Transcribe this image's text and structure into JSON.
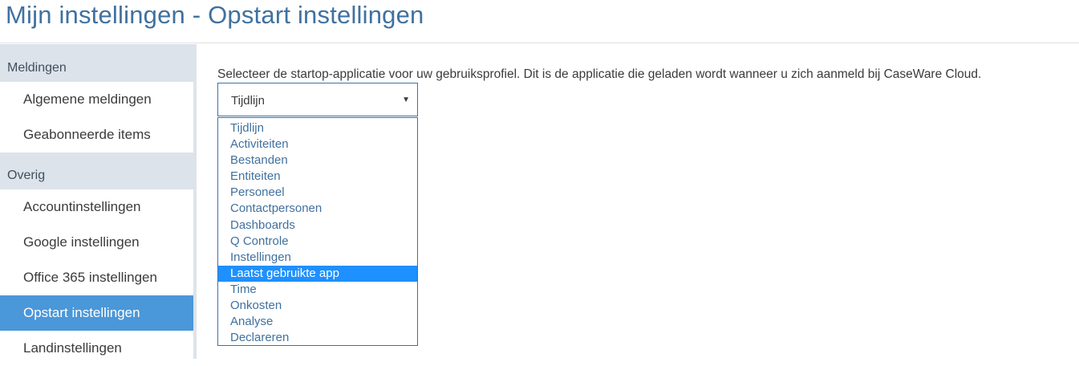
{
  "header": {
    "title": "Mijn instellingen - Opstart instellingen"
  },
  "sidebar": {
    "sections": [
      {
        "label": "Meldingen",
        "items": [
          {
            "label": "Algemene meldingen"
          },
          {
            "label": "Geabonneerde items"
          }
        ]
      },
      {
        "label": "Overig",
        "items": [
          {
            "label": "Accountinstellingen"
          },
          {
            "label": "Google instellingen"
          },
          {
            "label": "Office 365 instellingen"
          },
          {
            "label": "Opstart instellingen",
            "active": true
          },
          {
            "label": "Landinstellingen"
          }
        ]
      }
    ]
  },
  "main": {
    "description": "Selecteer de startop-applicatie voor uw gebruiksprofiel. Dit is de applicatie die geladen wordt wanneer u zich aanmeld bij CaseWare Cloud.",
    "select": {
      "value": "Tijdlijn",
      "arrow_icon": "caret-down-icon",
      "options": [
        "Tijdlijn",
        "Activiteiten",
        "Bestanden",
        "Entiteiten",
        "Personeel",
        "Contactpersonen",
        "Dashboards",
        "Q Controle",
        "Instellingen",
        "Laatst gebruikte app",
        "Time",
        "Onkosten",
        "Analyse",
        "Declareren"
      ],
      "highlighted_option": "Laatst gebruikte app"
    }
  },
  "colors": {
    "title": "#40719f",
    "sidebar_bg": "#dde3ea",
    "active_item": "#4a97d9",
    "highlight": "#1e90ff",
    "option_text": "#40719f"
  }
}
